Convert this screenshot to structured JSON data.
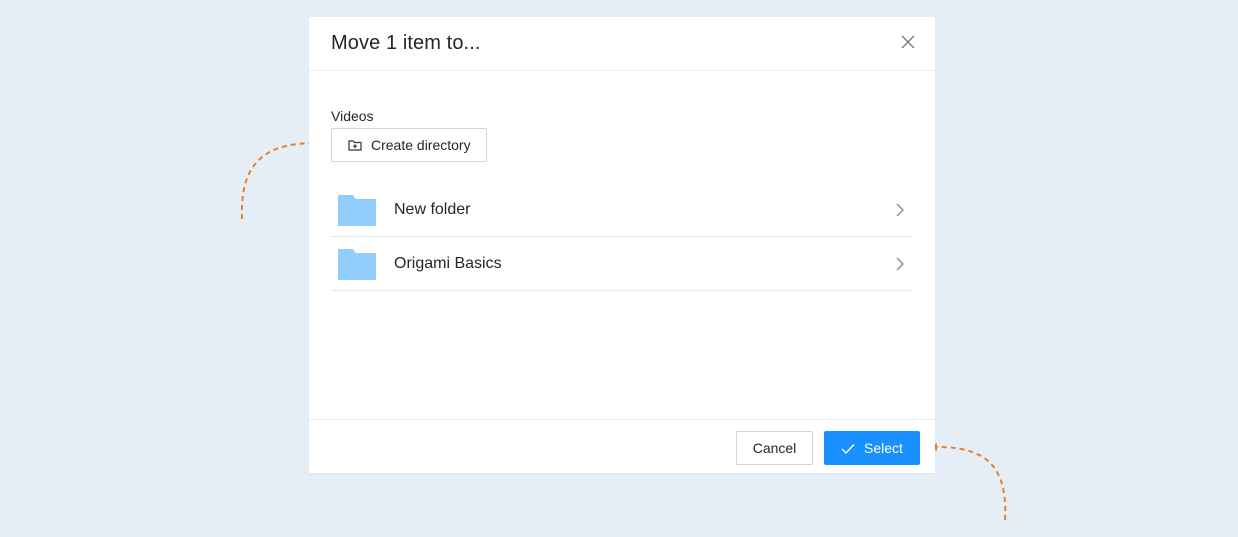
{
  "dialog": {
    "title": "Move 1 item to...",
    "breadcrumb": "Videos",
    "create_directory_label": "Create directory",
    "folders": [
      {
        "name": "New folder",
        "icon": "folder-icon"
      },
      {
        "name": "Origami Basics",
        "icon": "folder-icon"
      }
    ],
    "cancel_label": "Cancel",
    "select_label": "Select"
  },
  "colors": {
    "page_background": "#e5edf6",
    "primary": "#1890ff",
    "folder": "#91cdfd",
    "annotation_arrow": "#e8822a"
  },
  "icons": {
    "close": "close-icon",
    "create_directory": "folder-plus-icon",
    "chevron": "chevron-right-icon",
    "select": "check-icon"
  }
}
